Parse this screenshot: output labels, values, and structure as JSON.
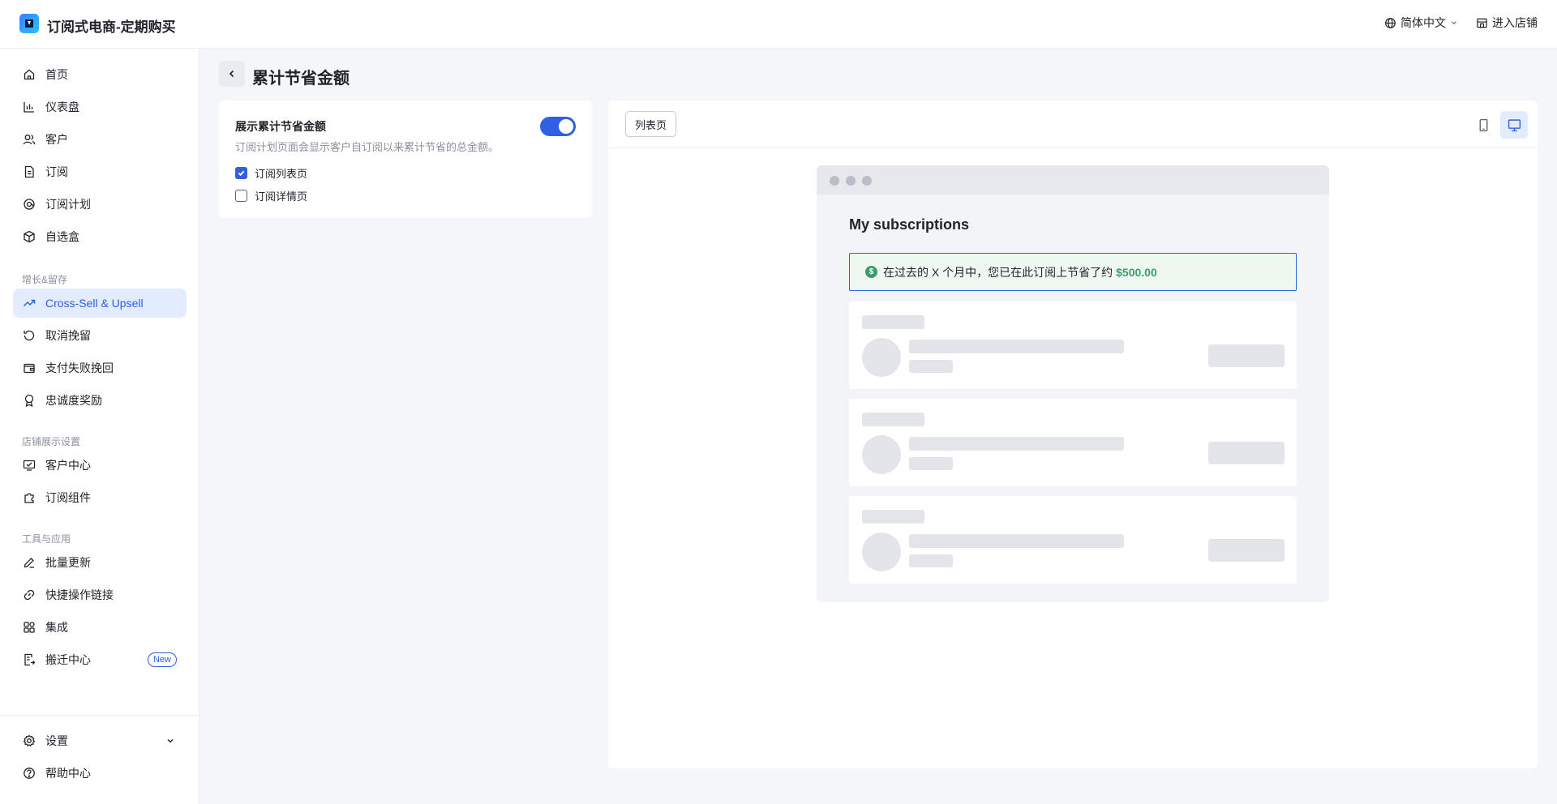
{
  "app": {
    "title": "订阅式电商-定期购买"
  },
  "topbar": {
    "language": "简体中文",
    "enter_store": "进入店铺"
  },
  "sidebar": {
    "items": [
      {
        "label": "首页",
        "icon": "home-icon"
      },
      {
        "label": "仪表盘",
        "icon": "bar-chart-icon"
      },
      {
        "label": "客户",
        "icon": "users-icon"
      },
      {
        "label": "订阅",
        "icon": "document-icon"
      },
      {
        "label": "订阅计划",
        "icon": "plan-icon"
      },
      {
        "label": "自选盒",
        "icon": "box-icon"
      }
    ],
    "section_growth": "增长&留存",
    "growth_items": [
      {
        "label": "Cross-Sell & Upsell",
        "icon": "trending-up-icon",
        "active": true
      },
      {
        "label": "取消挽留",
        "icon": "refresh-icon"
      },
      {
        "label": "支付失败挽回",
        "icon": "wallet-icon"
      },
      {
        "label": "忠诚度奖励",
        "icon": "award-icon"
      }
    ],
    "section_store": "店铺展示设置",
    "store_items": [
      {
        "label": "客户中心",
        "icon": "monitor-icon"
      },
      {
        "label": "订阅组件",
        "icon": "puzzle-icon"
      }
    ],
    "section_tools": "工具与应用",
    "tool_items": [
      {
        "label": "批量更新",
        "icon": "edit-icon"
      },
      {
        "label": "快捷操作链接",
        "icon": "link-icon"
      },
      {
        "label": "集成",
        "icon": "grid-icon"
      },
      {
        "label": "搬迁中心",
        "icon": "migrate-icon",
        "badge": "New"
      }
    ],
    "settings": "设置",
    "help": "帮助中心"
  },
  "page": {
    "title": "累计节省金额",
    "setting_title": "展示累计节省金额",
    "setting_desc": "订阅计划页面会显示客户自订阅以来累计节省的总金额。",
    "toggle_on": true,
    "option_list": "订阅列表页",
    "option_list_checked": true,
    "option_detail": "订阅详情页",
    "option_detail_checked": false
  },
  "preview": {
    "tab_label": "列表页",
    "device_mobile": "mobile-icon",
    "device_desktop": "desktop-icon",
    "heading": "My subscriptions",
    "banner_text": "在过去的 X 个月中，您已在此订阅上节省了约",
    "banner_amount": "$500.00",
    "accent_color": "#2f5fe3",
    "savings_color": "#3d9a6b"
  }
}
